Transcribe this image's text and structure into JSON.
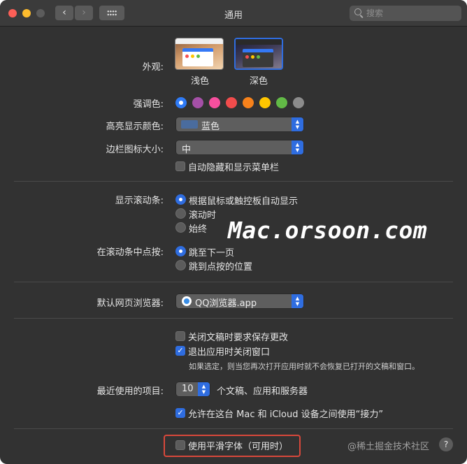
{
  "window": {
    "title": "通用"
  },
  "search": {
    "placeholder": "搜索"
  },
  "appearance": {
    "label": "外观:",
    "light": "浅色",
    "dark": "深色"
  },
  "accent": {
    "label": "强调色:",
    "colors": [
      "#2f7bf6",
      "#a550a7",
      "#f74f9e",
      "#f14c4c",
      "#f7821b",
      "#ffc600",
      "#62ba46",
      "#8c8c8c"
    ]
  },
  "highlight_color": {
    "label": "高亮显示颜色:",
    "value": "蓝色",
    "swatch": "#4a6c9e"
  },
  "sidebar_icon_size": {
    "label": "边栏图标大小:",
    "value": "中"
  },
  "menu_bar": {
    "label": "自动隐藏和显示菜单栏"
  },
  "scroll_bars": {
    "label": "显示滚动条:",
    "options": [
      "根据鼠标或触控板自动显示",
      "滚动时",
      "始终"
    ]
  },
  "click_scroll": {
    "label": "在滚动条中点按:",
    "options": [
      "跳至下一页",
      "跳到点按的位置"
    ]
  },
  "browser": {
    "label": "默认网页浏览器:",
    "value": "QQ浏览器.app"
  },
  "documents": {
    "ask_save": "关闭文稿时要求保存更改",
    "close_windows": "退出应用时关闭窗口",
    "hint": "如果选定，则当您再次打开应用时就不会恢复已打开的文稿和窗口。"
  },
  "recent": {
    "label": "最近使用的项目:",
    "value": "10",
    "suffix": "个文稿、应用和服务器"
  },
  "handoff": {
    "label": "允许在这台 Mac 和 iCloud 设备之间使用“接力”"
  },
  "font_smoothing": {
    "label": "使用平滑字体（可用时）"
  },
  "watermarks": {
    "site": "Mac.orsoon.com",
    "footer": "@稀土掘金技术社区"
  },
  "help": {
    "label": "?"
  }
}
